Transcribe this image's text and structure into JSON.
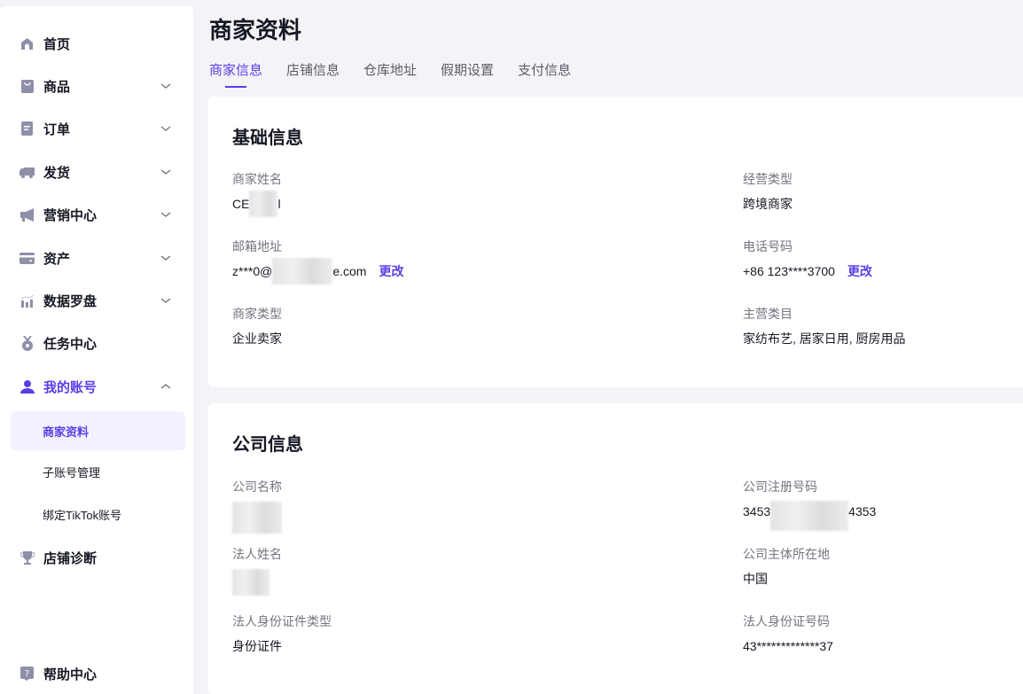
{
  "sidebar": {
    "items": [
      {
        "label": "首页",
        "icon": "home-icon"
      },
      {
        "label": "商品",
        "icon": "bag-icon"
      },
      {
        "label": "订单",
        "icon": "order-icon"
      },
      {
        "label": "发货",
        "icon": "truck-icon"
      },
      {
        "label": "营销中心",
        "icon": "megaphone-icon"
      },
      {
        "label": "资产",
        "icon": "card-icon"
      },
      {
        "label": "数据罗盘",
        "icon": "chart-icon"
      },
      {
        "label": "任务中心",
        "icon": "medal-icon"
      },
      {
        "label": "我的账号",
        "icon": "user-icon"
      },
      {
        "label": "店铺诊断",
        "icon": "trophy-icon"
      },
      {
        "label": "帮助中心",
        "icon": "help-icon"
      }
    ],
    "subitems": [
      "商家资料",
      "子账号管理",
      "绑定TikTok账号"
    ]
  },
  "page": {
    "title": "商家资料",
    "tabs": [
      "商家信息",
      "店铺信息",
      "仓库地址",
      "假期设置",
      "支付信息"
    ]
  },
  "basic": {
    "title": "基础信息",
    "fields": [
      {
        "label": "商家姓名",
        "value": "CE",
        "suffix": "l"
      },
      {
        "label": "经营类型",
        "value": "跨境商家"
      },
      {
        "label": "邮箱地址",
        "value": "z***0@",
        "suffix": "e.com",
        "action": "更改"
      },
      {
        "label": "电话号码",
        "value": "+86 123****3700",
        "action": "更改"
      },
      {
        "label": "商家类型",
        "value": "企业卖家"
      },
      {
        "label": "主营类目",
        "value": "家纺布艺, 居家日用, 厨房用品"
      }
    ]
  },
  "company": {
    "title": "公司信息",
    "fields": [
      {
        "label": "公司名称",
        "value": ""
      },
      {
        "label": "公司注册号码",
        "value": "3453",
        "suffix": "4353"
      },
      {
        "label": "法人姓名",
        "value": ""
      },
      {
        "label": "公司主体所在地",
        "value": "中国"
      },
      {
        "label": "法人身份证件类型",
        "value": "身份证件"
      },
      {
        "label": "法人身份证号码",
        "value": "43*************37"
      }
    ]
  }
}
